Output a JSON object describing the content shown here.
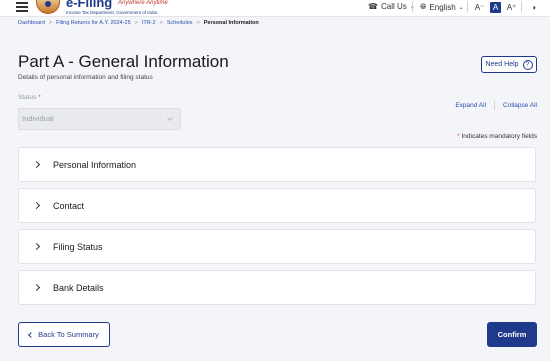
{
  "header": {
    "logo_title": "e-Filing",
    "logo_tagline": "Anywhere Anytime",
    "logo_subtitle": "Income Tax Department, Government of India",
    "call_us": "Call Us",
    "language": "English",
    "font_small": "A⁻",
    "font_normal": "A",
    "font_large": "A⁺",
    "contrast_icon": "contrast-icon"
  },
  "breadcrumb": [
    "Dashboard",
    "Filing Returns for A.Y. 2024-25",
    "ITR-2",
    "Schedules",
    "Personal Information"
  ],
  "page": {
    "title": "Part A - General Information",
    "subtitle": "Details of personal information and filing status",
    "need_help": "Need Help",
    "need_help_icon": "?"
  },
  "status": {
    "label": "Status",
    "required_mark": "*",
    "value": "Individual"
  },
  "links": {
    "expand_all": "Expand All",
    "collapse_all": "Collapse All"
  },
  "mandatory_note": {
    "mark": "*",
    "text": "Indicates mandatory fields"
  },
  "sections": [
    {
      "label": "Personal Information"
    },
    {
      "label": "Contact"
    },
    {
      "label": "Filing Status"
    },
    {
      "label": "Bank Details"
    }
  ],
  "footer": {
    "back_label": "Back To Summary",
    "confirm_label": "Confirm"
  },
  "colors": {
    "primary": "#1f3a8a",
    "link": "#2b4fb0",
    "background": "#f4f5f8",
    "required": "#d9534f"
  }
}
